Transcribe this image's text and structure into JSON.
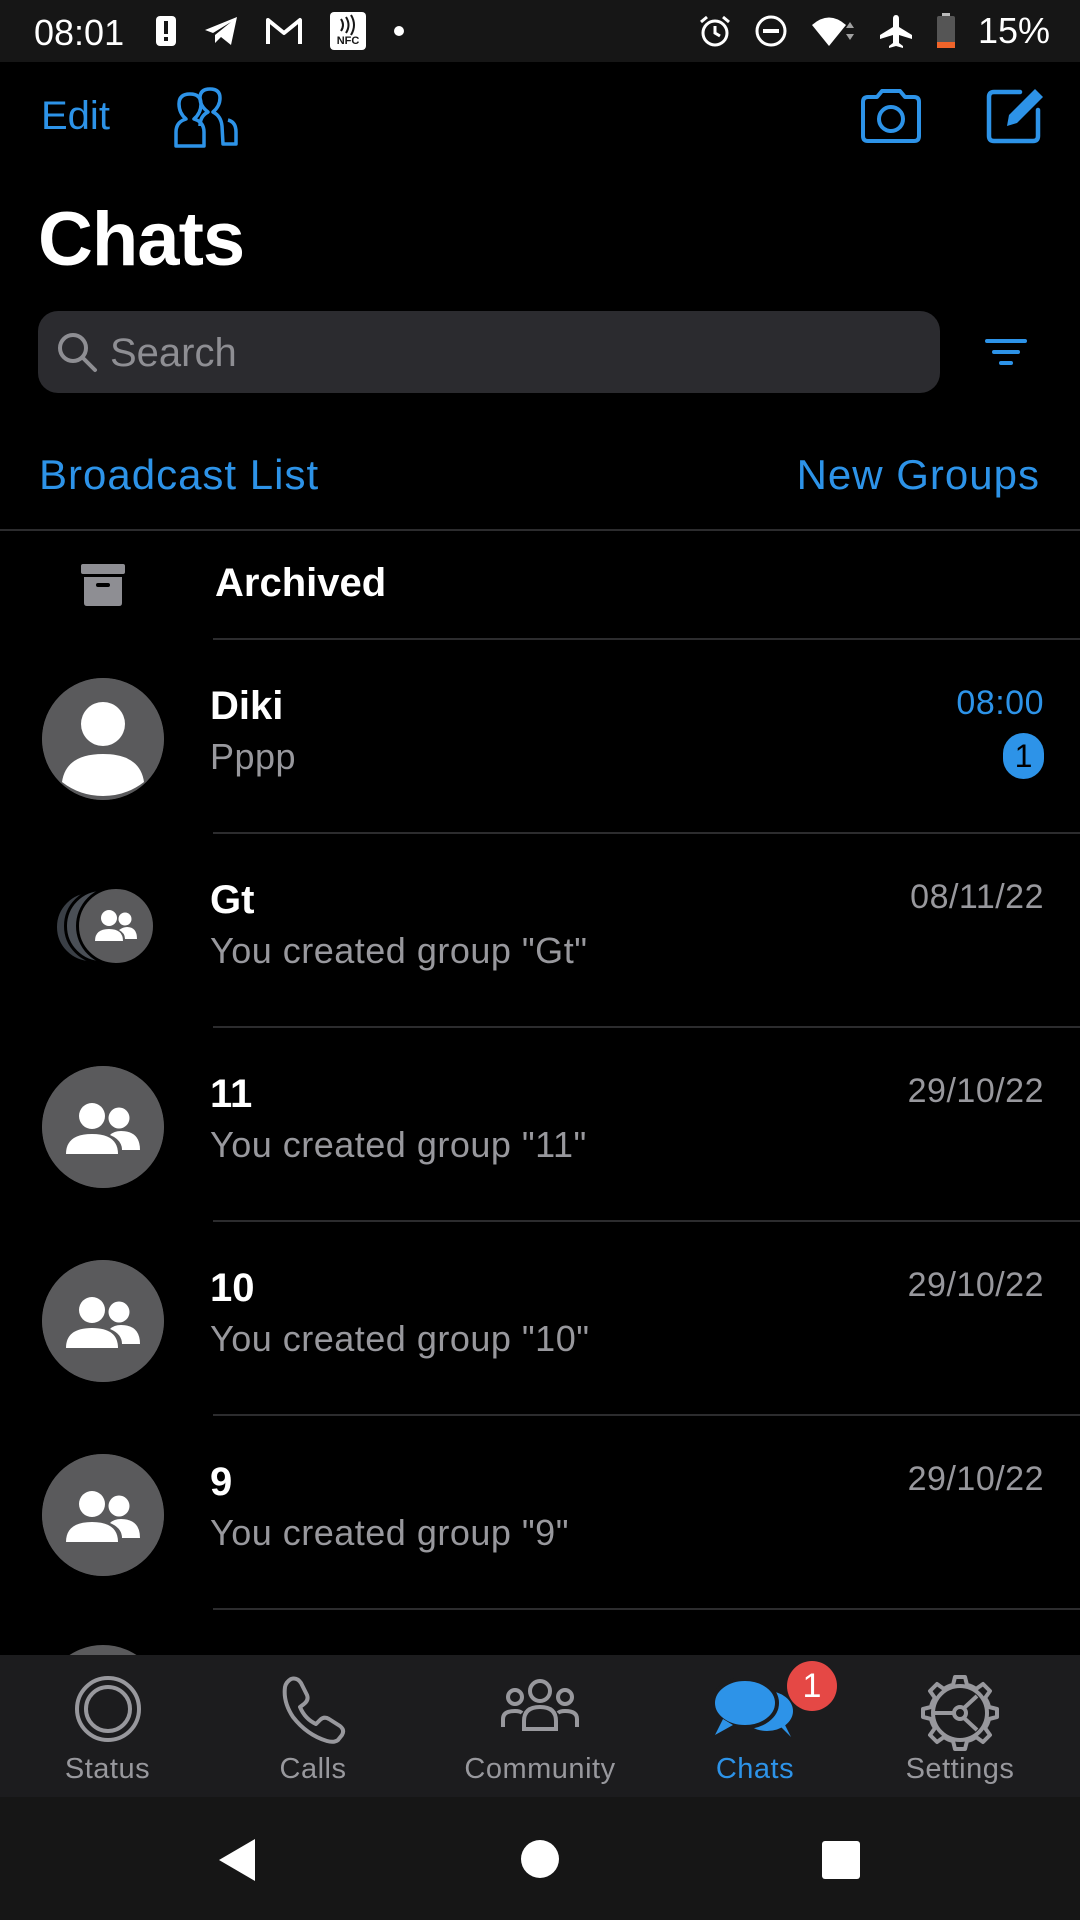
{
  "status_bar": {
    "time": "08:01",
    "left_icons": [
      "alert-icon",
      "telegram-icon",
      "gmail-icon",
      "nfc-icon",
      "dot-icon"
    ],
    "right_icons": [
      "alarm-icon",
      "dnd-icon",
      "wifi-icon",
      "airplane-icon",
      "battery-icon"
    ],
    "battery": "15%"
  },
  "header": {
    "edit_label": "Edit",
    "title": "Chats",
    "icons": [
      "people-icon",
      "camera-icon",
      "compose-icon"
    ]
  },
  "search": {
    "placeholder": "Search"
  },
  "links": {
    "broadcast": "Broadcast List",
    "new_groups": "New Groups"
  },
  "archived": {
    "label": "Archived"
  },
  "chats": [
    {
      "name": "Diki",
      "message": "Pppp",
      "time": "08:00",
      "unread": "1"
    },
    {
      "name": "Gt",
      "message": "You created group \"Gt\"",
      "time": "08/11/22"
    },
    {
      "name": "11",
      "message": "You created group \"11\"",
      "time": "29/10/22"
    },
    {
      "name": "10",
      "message": "You created group \"10\"",
      "time": "29/10/22"
    },
    {
      "name": "9",
      "message": "You created group \"9\"",
      "time": "29/10/22"
    }
  ],
  "tabs": [
    {
      "label": "Status"
    },
    {
      "label": "Calls"
    },
    {
      "label": "Community"
    },
    {
      "label": "Chats",
      "active": true,
      "badge": "1"
    },
    {
      "label": "Settings"
    }
  ],
  "colors": {
    "accent": "#2d93e8",
    "badge": "#e54845",
    "background": "#000000"
  }
}
